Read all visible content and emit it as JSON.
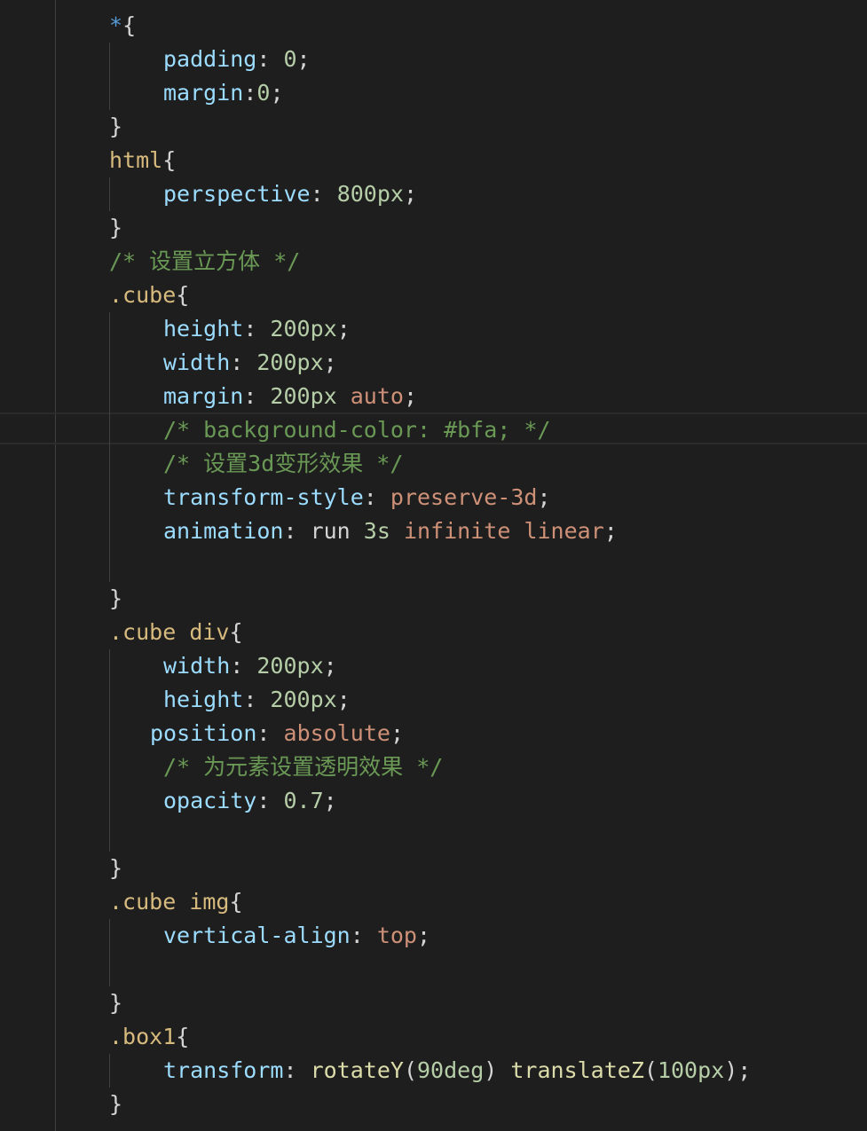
{
  "editor": {
    "language": "css",
    "theme_colors": {
      "background": "#1e1e1e",
      "selector": "#d7ba7d",
      "property": "#9cdcfe",
      "number": "#b5cea8",
      "value": "#ce9178",
      "comment": "#6a9955",
      "punctuation": "#d4d4d4",
      "keyword": "#569cd6",
      "function": "#dcdcaa"
    }
  },
  "lines": [
    {
      "indent": 123,
      "tokens": [
        {
          "t": "*",
          "c": "star"
        },
        {
          "t": "{",
          "c": "punc"
        }
      ]
    },
    {
      "indent": 184,
      "tokens": [
        {
          "t": "padding",
          "c": "prop"
        },
        {
          "t": ": ",
          "c": "punc"
        },
        {
          "t": "0",
          "c": "num"
        },
        {
          "t": ";",
          "c": "punc"
        }
      ]
    },
    {
      "indent": 184,
      "tokens": [
        {
          "t": "margin",
          "c": "prop"
        },
        {
          "t": ":",
          "c": "punc"
        },
        {
          "t": "0",
          "c": "num"
        },
        {
          "t": ";",
          "c": "punc"
        }
      ]
    },
    {
      "indent": 123,
      "tokens": [
        {
          "t": "}",
          "c": "punc"
        }
      ]
    },
    {
      "indent": 123,
      "tokens": [
        {
          "t": "html",
          "c": "sel"
        },
        {
          "t": "{",
          "c": "punc"
        }
      ]
    },
    {
      "indent": 184,
      "tokens": [
        {
          "t": "perspective",
          "c": "prop"
        },
        {
          "t": ": ",
          "c": "punc"
        },
        {
          "t": "800px",
          "c": "num"
        },
        {
          "t": ";",
          "c": "punc"
        }
      ]
    },
    {
      "indent": 123,
      "tokens": [
        {
          "t": "}",
          "c": "punc"
        }
      ]
    },
    {
      "indent": 123,
      "tokens": [
        {
          "t": "/* 设置立方体 */",
          "c": "com"
        }
      ]
    },
    {
      "indent": 123,
      "tokens": [
        {
          "t": ".cube",
          "c": "sel"
        },
        {
          "t": "{",
          "c": "punc"
        }
      ]
    },
    {
      "indent": 184,
      "tokens": [
        {
          "t": "height",
          "c": "prop"
        },
        {
          "t": ": ",
          "c": "punc"
        },
        {
          "t": "200px",
          "c": "num"
        },
        {
          "t": ";",
          "c": "punc"
        }
      ]
    },
    {
      "indent": 184,
      "tokens": [
        {
          "t": "width",
          "c": "prop"
        },
        {
          "t": ": ",
          "c": "punc"
        },
        {
          "t": "200px",
          "c": "num"
        },
        {
          "t": ";",
          "c": "punc"
        }
      ]
    },
    {
      "indent": 184,
      "tokens": [
        {
          "t": "margin",
          "c": "prop"
        },
        {
          "t": ": ",
          "c": "punc"
        },
        {
          "t": "200px",
          "c": "num"
        },
        {
          "t": " ",
          "c": "punc"
        },
        {
          "t": "auto",
          "c": "val"
        },
        {
          "t": ";",
          "c": "punc"
        }
      ]
    },
    {
      "indent": 184,
      "current": true,
      "tokens": [
        {
          "t": "/* background-color: #bfa; */",
          "c": "com"
        }
      ]
    },
    {
      "indent": 184,
      "tokens": [
        {
          "t": "/* 设置3d变形效果 */",
          "c": "com"
        }
      ]
    },
    {
      "indent": 184,
      "tokens": [
        {
          "t": "transform-style",
          "c": "prop"
        },
        {
          "t": ": ",
          "c": "punc"
        },
        {
          "t": "preserve-3d",
          "c": "val"
        },
        {
          "t": ";",
          "c": "punc"
        }
      ]
    },
    {
      "indent": 184,
      "tokens": [
        {
          "t": "animation",
          "c": "prop"
        },
        {
          "t": ": ",
          "c": "punc"
        },
        {
          "t": "run",
          "c": "punc"
        },
        {
          "t": " ",
          "c": "punc"
        },
        {
          "t": "3s",
          "c": "num"
        },
        {
          "t": " ",
          "c": "punc"
        },
        {
          "t": "infinite",
          "c": "val"
        },
        {
          "t": " ",
          "c": "punc"
        },
        {
          "t": "linear",
          "c": "val"
        },
        {
          "t": ";",
          "c": "punc"
        }
      ]
    },
    {
      "indent": 184,
      "tokens": []
    },
    {
      "indent": 123,
      "tokens": [
        {
          "t": "}",
          "c": "punc"
        }
      ]
    },
    {
      "indent": 123,
      "tokens": [
        {
          "t": ".cube",
          "c": "sel"
        },
        {
          "t": " ",
          "c": "punc"
        },
        {
          "t": "div",
          "c": "sel"
        },
        {
          "t": "{",
          "c": "punc"
        }
      ]
    },
    {
      "indent": 184,
      "tokens": [
        {
          "t": "width",
          "c": "prop"
        },
        {
          "t": ": ",
          "c": "punc"
        },
        {
          "t": "200px",
          "c": "num"
        },
        {
          "t": ";",
          "c": "punc"
        }
      ]
    },
    {
      "indent": 184,
      "tokens": [
        {
          "t": "height",
          "c": "prop"
        },
        {
          "t": ": ",
          "c": "punc"
        },
        {
          "t": "200px",
          "c": "num"
        },
        {
          "t": ";",
          "c": "punc"
        }
      ]
    },
    {
      "indent": 169,
      "tokens": [
        {
          "t": "position",
          "c": "prop"
        },
        {
          "t": ": ",
          "c": "punc"
        },
        {
          "t": "absolute",
          "c": "val"
        },
        {
          "t": ";",
          "c": "punc"
        }
      ]
    },
    {
      "indent": 184,
      "tokens": [
        {
          "t": "/* 为元素设置透明效果 */",
          "c": "com"
        }
      ]
    },
    {
      "indent": 184,
      "tokens": [
        {
          "t": "opacity",
          "c": "prop"
        },
        {
          "t": ": ",
          "c": "punc"
        },
        {
          "t": "0.7",
          "c": "num"
        },
        {
          "t": ";",
          "c": "punc"
        }
      ]
    },
    {
      "indent": 184,
      "tokens": []
    },
    {
      "indent": 123,
      "tokens": [
        {
          "t": "}",
          "c": "punc"
        }
      ]
    },
    {
      "indent": 123,
      "tokens": [
        {
          "t": ".cube",
          "c": "sel"
        },
        {
          "t": " ",
          "c": "punc"
        },
        {
          "t": "img",
          "c": "sel"
        },
        {
          "t": "{",
          "c": "punc"
        }
      ]
    },
    {
      "indent": 184,
      "tokens": [
        {
          "t": "vertical-align",
          "c": "prop"
        },
        {
          "t": ": ",
          "c": "punc"
        },
        {
          "t": "top",
          "c": "val"
        },
        {
          "t": ";",
          "c": "punc"
        }
      ]
    },
    {
      "indent": 184,
      "tokens": []
    },
    {
      "indent": 123,
      "tokens": [
        {
          "t": "}",
          "c": "punc"
        }
      ]
    },
    {
      "indent": 123,
      "tokens": [
        {
          "t": ".box1",
          "c": "sel"
        },
        {
          "t": "{",
          "c": "punc"
        }
      ]
    },
    {
      "indent": 184,
      "tokens": [
        {
          "t": "transform",
          "c": "prop"
        },
        {
          "t": ": ",
          "c": "punc"
        },
        {
          "t": "rotateY",
          "c": "fn"
        },
        {
          "t": "(",
          "c": "punc"
        },
        {
          "t": "90deg",
          "c": "num"
        },
        {
          "t": ") ",
          "c": "punc"
        },
        {
          "t": "translateZ",
          "c": "fn"
        },
        {
          "t": "(",
          "c": "punc"
        },
        {
          "t": "100px",
          "c": "num"
        },
        {
          "t": ");",
          "c": "punc"
        }
      ]
    },
    {
      "indent": 123,
      "tokens": [
        {
          "t": "}",
          "c": "punc"
        }
      ]
    }
  ]
}
